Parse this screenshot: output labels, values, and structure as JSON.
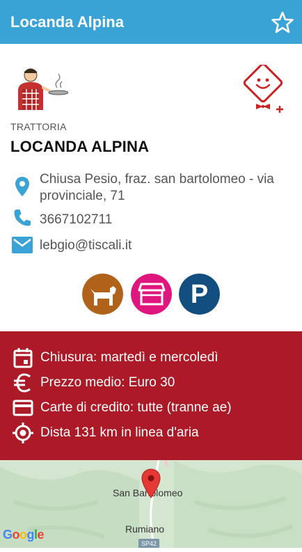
{
  "appbar": {
    "title": "Locanda Alpina",
    "favorite_icon": "star-outline-icon"
  },
  "restaurant": {
    "category": "TRATTORIA",
    "name": "LOCANDA ALPINA"
  },
  "contact": {
    "address": "Chiusa Pesio, fraz. san bartolomeo - via provinciale, 71",
    "phone": "3667102711",
    "email": "lebgio@tiscali.it"
  },
  "amenities": [
    {
      "icon": "dog-icon",
      "color": "#b0621a"
    },
    {
      "icon": "toolbox-icon",
      "color": "#e0167f"
    },
    {
      "icon": "parking-icon",
      "color": "#124f80"
    }
  ],
  "details": {
    "closing": "Chiusura: martedì e mercoledì",
    "avg_price": "Prezzo medio: Euro 30",
    "cards": "Carte di credito: tutte (tranne ae)",
    "distance": "Dista 131 km in linea d'aria"
  },
  "map": {
    "label_main": "San Bartolomeo",
    "label_secondary": "Rumiano",
    "road": "SP42",
    "google": [
      "G",
      "o",
      "o",
      "g",
      "l",
      "e"
    ]
  },
  "colors": {
    "appbar": "#3aa3d6",
    "panel": "#ab1a26",
    "icon_blue": "#3aa3d6"
  }
}
